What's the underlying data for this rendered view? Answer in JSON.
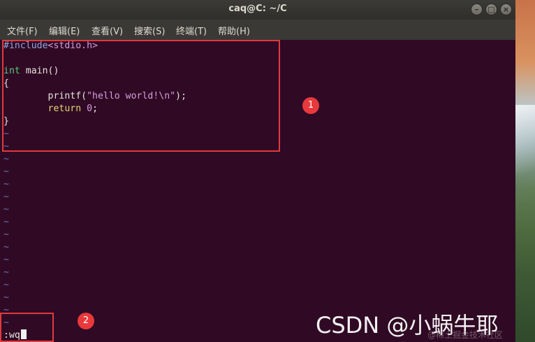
{
  "window": {
    "title": "caq@C: ~/C",
    "controls": {
      "minimize": "–",
      "maximize": "□",
      "close": "×"
    }
  },
  "menubar": {
    "items": [
      "文件(F)",
      "编辑(E)",
      "查看(V)",
      "搜索(S)",
      "终端(T)",
      "帮助(H)"
    ]
  },
  "editor": {
    "code": {
      "include_directive": "#include",
      "include_header": "<stdio.h>",
      "main_type": "int",
      "main_signature": " main()",
      "open_brace": "{",
      "printf_indent": "        printf(",
      "printf_string": "\"hello world!\\n\"",
      "printf_end": ");",
      "return_indent": "        ",
      "return_keyword": "return",
      "return_value": "0",
      "return_end": ";",
      "close_brace": "}"
    },
    "tilde": "~",
    "command_line": ":wq"
  },
  "annotations": {
    "badge_1": "1",
    "badge_2": "2",
    "box_color": "#e03a3e"
  },
  "watermark": {
    "text": "CSDN @小蜗牛耶",
    "sub_text": "@稀土掘金技术社区"
  }
}
